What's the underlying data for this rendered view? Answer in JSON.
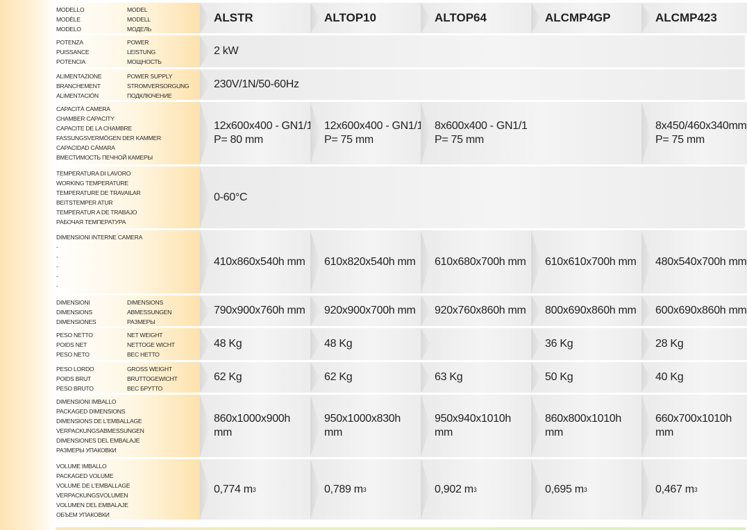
{
  "header": {
    "labels_left": [
      "MODELLO",
      "MODÈLE",
      "MODELO"
    ],
    "labels_right": [
      "MODEL",
      "MODELL",
      "МОДЕЛЬ"
    ],
    "models": [
      "ALSTR",
      "ALTOP10",
      "ALTOP64",
      "ALCMP4GP",
      "ALCMP423"
    ]
  },
  "rows": {
    "power": {
      "labels_left": [
        "POTENZA",
        "PUISSANCE",
        "POTENCIA"
      ],
      "labels_right": [
        "POWER",
        "LEISTUNG",
        "МОЩНОСТЬ"
      ],
      "value": "2 kW"
    },
    "supply": {
      "labels_left": [
        "ALIMENTAZIONE",
        "BRANCHEMENT",
        "ALIMENTACIÓN"
      ],
      "labels_right": [
        "POWER SUPPLY",
        "STROMVERSORGUNG",
        "ПОДКЛЮЧЕНИЕ"
      ],
      "value": "230V/1N/50-60Hz"
    },
    "capacity": {
      "labels": [
        "CAPACITÀ CAMERA",
        "CHAMBER CAPACITY",
        "CAPACITE DE LA CHAMBRE",
        "FASSUNGSVERMÖGEN DER KAMMER",
        "CAPACIDAD CÁMARA",
        "ВМЕСТИМОСТЬ ПЕЧНОЙ КАМЕРЫ"
      ],
      "values": [
        [
          "12x600x400 - GN1/1",
          "P= 80 mm"
        ],
        [
          "12x600x400 - GN1/1",
          "P= 75 mm"
        ],
        [
          "8x600x400 - GN1/1",
          "P= 75 mm"
        ],
        [
          "",
          ""
        ],
        [
          "8x450/460x340mm",
          "P= 75 mm"
        ]
      ]
    },
    "temperature": {
      "labels": [
        "TEMPERATURA DI LAVORO",
        "WORKING TEMPERATURE",
        "TEMPERATURE DE TRAVAILAR",
        "BEITSTEMPER ATUR",
        "TEMPERATUR A DE TRABAJO",
        "РАБОЧАЯ ТЕМПЕРАТУРА"
      ],
      "value": "0-60°C"
    },
    "internal_dims": {
      "labels": [
        "DIMENSIONI INTERNE CAMERA",
        "-",
        "-",
        "-",
        "-",
        "-"
      ],
      "values": [
        "410x860x540h mm",
        "610x820x540h mm",
        "610x680x700h mm",
        "610x610x700h mm",
        "480x540x700h mm"
      ]
    },
    "dimensions": {
      "labels_left": [
        "DIMENSIONI",
        "DIMENSIONS",
        "DIMENSIONES"
      ],
      "labels_right": [
        "DIMENSIONS",
        "ABMESSUNGEN",
        "РАЗМЕРЫ"
      ],
      "values": [
        "790x900x760h mm",
        "920x900x700h mm",
        "920x760x860h mm",
        "800x690x860h mm",
        "600x690x860h mm"
      ]
    },
    "net_weight": {
      "labels_left": [
        "PESO NETTO",
        "POIDS NET",
        "PESO NETO"
      ],
      "labels_right": [
        "NET WEIGHT",
        "NETTOGE WICHT",
        "ВЕС НЕТТО"
      ],
      "values": [
        "48 Kg",
        "48 Kg",
        "",
        "36 Kg",
        "28 Kg"
      ]
    },
    "gross_weight": {
      "labels_left": [
        "PESO LORDO",
        "POIDS BRUT",
        "PESO BRUTO"
      ],
      "labels_right": [
        "GROSS WEIGHT",
        "BRUTTOGEWICHT",
        "ВЕС БРУТТО"
      ],
      "values": [
        "62 Kg",
        "62 Kg",
        "63 Kg",
        "50 Kg",
        "40 Kg"
      ]
    },
    "packaged_dims": {
      "labels": [
        "DIMENSIONI IMBALLO",
        "PACKAGED DIMENSIONS",
        "DIMENSIONS DE L'EMBALLAGE",
        "VERPACKUNGSABMESSUNGEN",
        "DIMENSIONES DEL EMBALAJE",
        "РАЗМЕРЫ УПАКОВКИ"
      ],
      "values": [
        "860x1000x900h mm",
        "950x1000x830h mm",
        "950x940x1010h mm",
        "860x800x1010h mm",
        "660x700x1010h mm"
      ]
    },
    "volume": {
      "labels": [
        "VOLUME IMBALLO",
        "PACKAGED VOLUME",
        "VOLUME DE L'EMBALLAGE",
        "VERPACKUNGSVOLUMEN",
        "VOLUMEN DEL EMBALAJE",
        "ОБЪЕМ УПАКОВКИ"
      ],
      "unit": "m",
      "unit_exp": "3",
      "values": [
        "0,774",
        "0,789",
        "0,902",
        "0,695",
        "0,467"
      ]
    }
  }
}
